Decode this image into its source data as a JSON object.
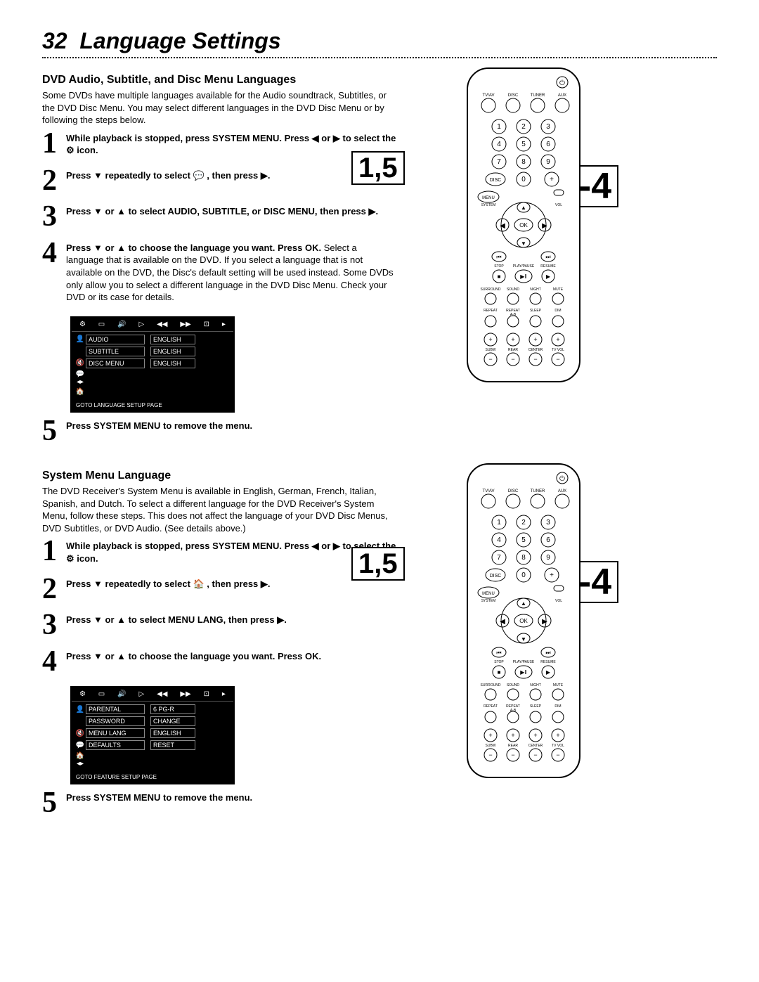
{
  "page_number": "32",
  "page_title": "Language Settings",
  "section1": {
    "title": "DVD Audio, Subtitle, and Disc Menu Languages",
    "intro": "Some DVDs have multiple languages available for the Audio soundtrack, Subtitles, or the DVD Disc Menu. You may select different languages in the DVD Disc Menu or by following the steps below.",
    "steps": [
      {
        "n": "1",
        "bold": "While playback is stopped, press SYSTEM MENU. Press ◀ or ▶ to select the ⚙ icon."
      },
      {
        "n": "2",
        "bold": "Press ▼ repeatedly to select 💬 , then press ▶."
      },
      {
        "n": "3",
        "bold": "Press ▼ or ▲ to select AUDIO, SUBTITLE, or DISC MENU, then press ▶."
      },
      {
        "n": "4",
        "bold": "Press ▼ or ▲ to choose the language you want. Press OK.",
        "norm": " Select a language that is available on the DVD. If you select a language that is not available on the DVD, the Disc's default setting will be used instead. Some DVDs only allow you to select a different language in the DVD Disc Menu. Check your DVD or its case for details."
      },
      {
        "n": "5",
        "bold": "Press SYSTEM MENU to remove the menu."
      }
    ],
    "osd": {
      "rows": [
        {
          "l": "AUDIO",
          "r": "ENGLISH"
        },
        {
          "l": "SUBTITLE",
          "r": "ENGLISH"
        },
        {
          "l": "DISC MENU",
          "r": "ENGLISH"
        }
      ],
      "footer": "GOTO LANGUAGE SETUP PAGE"
    }
  },
  "section2": {
    "title": "System Menu Language",
    "intro": "The DVD Receiver's System Menu is available in English, German, French, Italian, Spanish, and Dutch. To select a different language for the DVD Receiver's System Menu, follow these steps. This does not affect the language of your DVD Disc Menus, DVD Subtitles, or DVD Audio. (See details above.)",
    "steps": [
      {
        "n": "1",
        "bold": "While playback is stopped, press SYSTEM MENU. Press ◀ or ▶ to select the ⚙ icon."
      },
      {
        "n": "2",
        "bold": "Press ▼ repeatedly to select 🏠 , then press ▶."
      },
      {
        "n": "3",
        "bold": "Press ▼ or ▲ to select MENU LANG, then press ▶."
      },
      {
        "n": "4",
        "bold": "Press ▼ or ▲ to choose the language you want. Press OK."
      },
      {
        "n": "5",
        "bold": "Press SYSTEM MENU to remove the menu."
      }
    ],
    "osd": {
      "rows": [
        {
          "l": "PARENTAL",
          "r": "6 PG-R"
        },
        {
          "l": "PASSWORD",
          "r": "CHANGE"
        },
        {
          "l": "MENU LANG",
          "r": "ENGLISH"
        },
        {
          "l": "DEFAULTS",
          "r": "RESET"
        }
      ],
      "footer": "GOTO FEATURE SETUP PAGE"
    }
  },
  "callouts": {
    "a": "1,5",
    "b": "1-4"
  },
  "remote": {
    "top_row": [
      "TV/AV",
      "DISC",
      "TUNER",
      "AUX"
    ],
    "numpad": [
      "1",
      "2",
      "3",
      "4",
      "5",
      "6",
      "7",
      "8",
      "9",
      "DISC",
      "0",
      "+"
    ],
    "menu_label": "MENU",
    "system_label": "SYSTEM",
    "vol_label": "VOL",
    "ok_label": "OK",
    "transport_top": [
      "⏮",
      "▼",
      "⏭"
    ],
    "transport_labels": [
      "STOP",
      "PLAY/PAUSE",
      "RESUME"
    ],
    "transport_row": [
      "■",
      "▶‖",
      "▶"
    ],
    "sound_row1_labels": [
      "SURROUND",
      "SOUND",
      "NIGHT",
      "MUTE"
    ],
    "sound_row2_labels": [
      "REPEAT",
      "REPEAT A-B",
      "SLEEP",
      "DIM"
    ],
    "bottom_labels": [
      "SUBW",
      "REAR",
      "CENTER",
      "TV VOL"
    ]
  }
}
